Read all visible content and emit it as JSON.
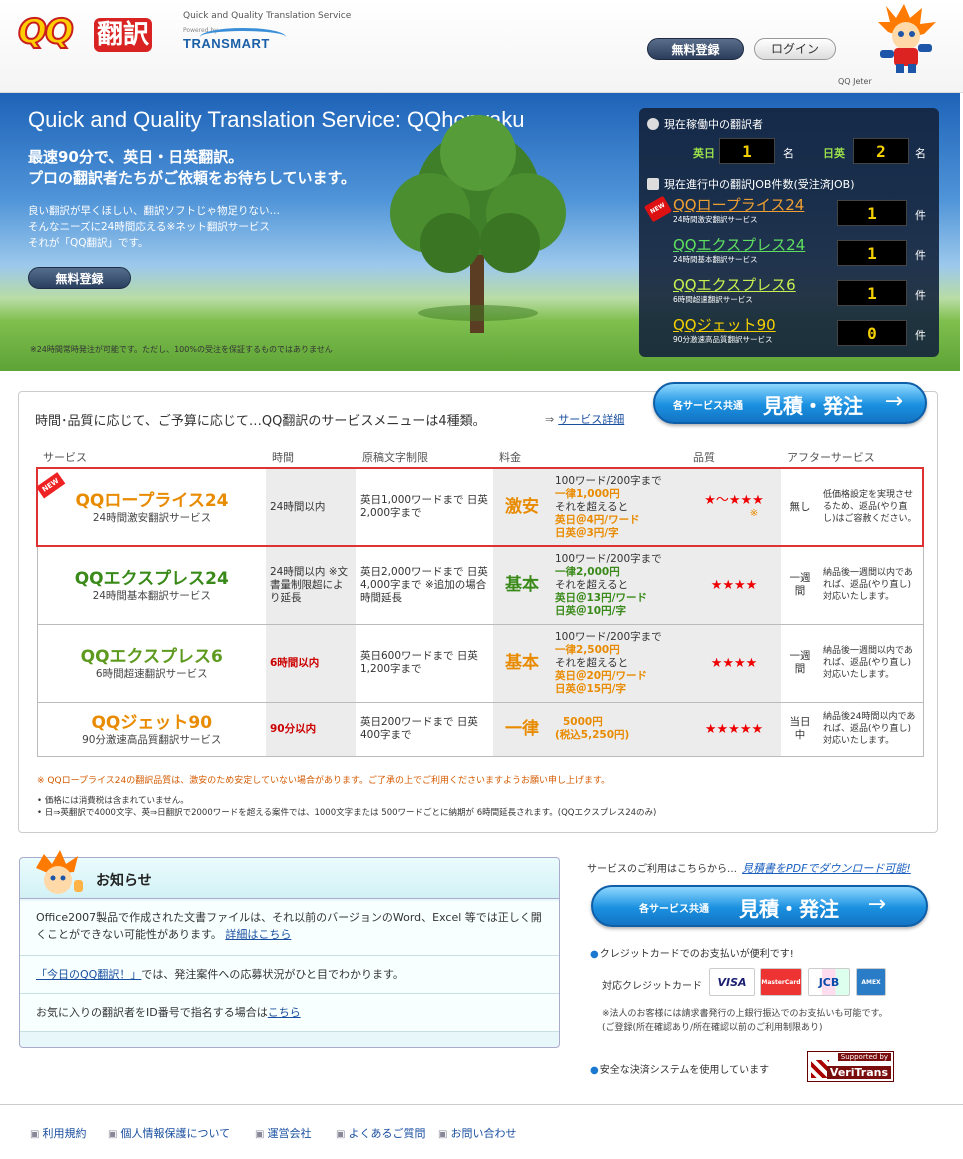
{
  "header": {
    "tagline": "Quick and Quality Translation Service",
    "powered_by": "Powered by",
    "transmart": "TRANSMART",
    "register_label": "無料登録",
    "login_label": "ログイン",
    "mascot_label": "QQ Jeter"
  },
  "hero": {
    "title": "Quick and Quality Translation Service: QQhonyaku",
    "headline1": "最速90分で、英日・日英翻訳。",
    "headline2": "プロの翻訳者たちがご依頼をお待ちしています。",
    "body1": "良い翻訳が早くほしい、翻訳ソフトじゃ物足りない…",
    "body2": "そんなニーズに24時間応える※ネット翻訳サービス",
    "body3": "それが「QQ翻訳」です。",
    "register_button": "無料登録",
    "note": "※24時間常時発注が可能です。ただし、100%の受注を保証するものではありません"
  },
  "status": {
    "translators_heading": "現在稼働中の翻訳者",
    "en_ja_label": "英日",
    "en_ja_count": "1",
    "ja_en_label": "日英",
    "ja_en_count": "2",
    "unit_person": "名",
    "jobs_heading": "現在進行中の翻訳JOB件数(受注済JOB)",
    "unit_job": "件",
    "new_tag": "NEW",
    "jobs": [
      {
        "name": "QQロープライス24",
        "sub": "24時間激安翻訳サービス",
        "count": "1",
        "color": "#f0a030"
      },
      {
        "name": "QQエクスプレス24",
        "sub": "24時間基本翻訳サービス",
        "count": "1",
        "color": "#5ee05e"
      },
      {
        "name": "QQエクスプレス6",
        "sub": "6時間超速翻訳サービス",
        "count": "1",
        "color": "#c8f050"
      },
      {
        "name": "QQジェット90",
        "sub": "90分激速高品質翻訳サービス",
        "count": "0",
        "color": "#f5d000"
      }
    ]
  },
  "services": {
    "heading": "時間･品質に応じて、ご予算に応じて…QQ翻訳のサービスメニューは4種類。",
    "detail_link": "サービス詳細",
    "order_button_small": "各サービス共通",
    "order_button_big": "見積・発注",
    "columns": [
      "サービス",
      "時間",
      "原稿文字制限",
      "料金",
      "",
      "品質",
      "アフターサービス",
      ""
    ],
    "new_ribbon": "NEW",
    "rows": [
      {
        "name": "QQロープライス24",
        "sub": "24時間激安翻訳サービス",
        "time": "24時間以内",
        "limit": "英日1,000ワードまで 日英2,000字まで",
        "price_label": "激安",
        "price_l1": "100ワード/200字まで",
        "price_l2": "一律1,000円",
        "price_l3": "それを超えると",
        "price_l4": "英日＠4円/ワード",
        "price_l5": "日英＠3円/字",
        "quality": "★～★★★",
        "quality_note": "※",
        "after": "無し",
        "after_note": "低価格設定を実現させるため、返品(やり直し)はご容赦ください。"
      },
      {
        "name": "QQエクスプレス24",
        "sub": "24時間基本翻訳サービス",
        "time": "24時間以内 ※文書量制限超により延長",
        "limit": "英日2,000ワードまで 日英4,000字まで ※追加の場合時間延長",
        "price_label": "基本",
        "price_l1": "100ワード/200字まで",
        "price_l2": "一律2,000円",
        "price_l3": "それを超えると",
        "price_l4": "英日＠13円/ワード",
        "price_l5": "日英＠10円/字",
        "quality": "★★★★",
        "quality_note": "",
        "after": "一週間",
        "after_note": "納品後一週間以内であれば、返品(やり直し)対応いたします。"
      },
      {
        "name": "QQエクスプレス6",
        "sub": "6時間超速翻訳サービス",
        "time": "6時間以内",
        "limit": "英日600ワードまで 日英1,200字まで",
        "price_label": "基本",
        "price_l1": "100ワード/200字まで",
        "price_l2": "一律2,500円",
        "price_l3": "それを超えると",
        "price_l4": "英日＠20円/ワード",
        "price_l5": "日英＠15円/字",
        "quality": "★★★★",
        "quality_note": "",
        "after": "一週間",
        "after_note": "納品後一週間以内であれば、返品(やり直し)対応いたします。"
      },
      {
        "name": "QQジェット90",
        "sub": "90分激速高品質翻訳サービス",
        "time": "90分以内",
        "limit": "英日200ワードまで 日英400字まで",
        "price_label": "一律",
        "price_l1": "5000円",
        "price_l2": "(税込5,250円)",
        "price_l3": "",
        "price_l4": "",
        "price_l5": "",
        "quality": "★★★★★",
        "quality_note": "",
        "after": "当日中",
        "after_note": "納品後24時間以内であれば、返品(やり直し)対応いたします。"
      }
    ],
    "footnote": "※ QQロープライス24の翻訳品質は、激安のため安定していない場合があります。ご了承の上でご利用くださいますようお願い申し上げます。",
    "note1": "• 価格には消費税は含まれていません。",
    "note2": "• 日⇒英翻訳で4000文字、英⇒日翻訳で2000ワードを超える案件では、1000文字または 500ワードごとに納期が 6時間延長されます。(QQエクスプレス24のみ)"
  },
  "news": {
    "title": "お知らせ",
    "item1_text": "Office2007製品で作成された文書ファイルは、それ以前のバージョンのWord、Excel 等では正しく開くことができない可能性があります。",
    "item1_link": "詳細はこちら",
    "item2_link": "「今日のQQ翻訳！」",
    "item2_text": "では、発注案件への応募状況がひと目でわかります。",
    "item3_text": "お気に入りの翻訳者をID番号で指名する場合は",
    "item3_link": "こちら"
  },
  "side": {
    "download_text": "サービスのご利用はこちらから…",
    "download_link": "見積書をPDFでダウンロード可能!",
    "order_button_small": "各サービス共通",
    "order_button_big": "見積・発注",
    "cc_heading": "クレジットカードでのお支払いが便利です!",
    "cc_label": "対応クレジットカード",
    "cards": [
      "VISA",
      "MasterCard",
      "JCB",
      "AMEX"
    ],
    "cc_note1": "※法人のお客様には請求書発行の上銀行振込でのお支払いも可能です。",
    "cc_note2": "(ご登録(所在確認あり/所在確認以前のご利用制限あり)",
    "security_heading": "安全な決済システムを使用しています",
    "veritrans_top": "Supported by",
    "veritrans_bottom": "VeriTrans"
  },
  "footer": {
    "links": [
      "利用規約",
      "個人情報保護について",
      "運営会社",
      "よくあるご質問",
      "お問い合わせ"
    ]
  },
  "colors": {
    "accent_blue": "#1a90e0",
    "hero_panel": "#14243c",
    "highlight_red": "#d33333"
  }
}
